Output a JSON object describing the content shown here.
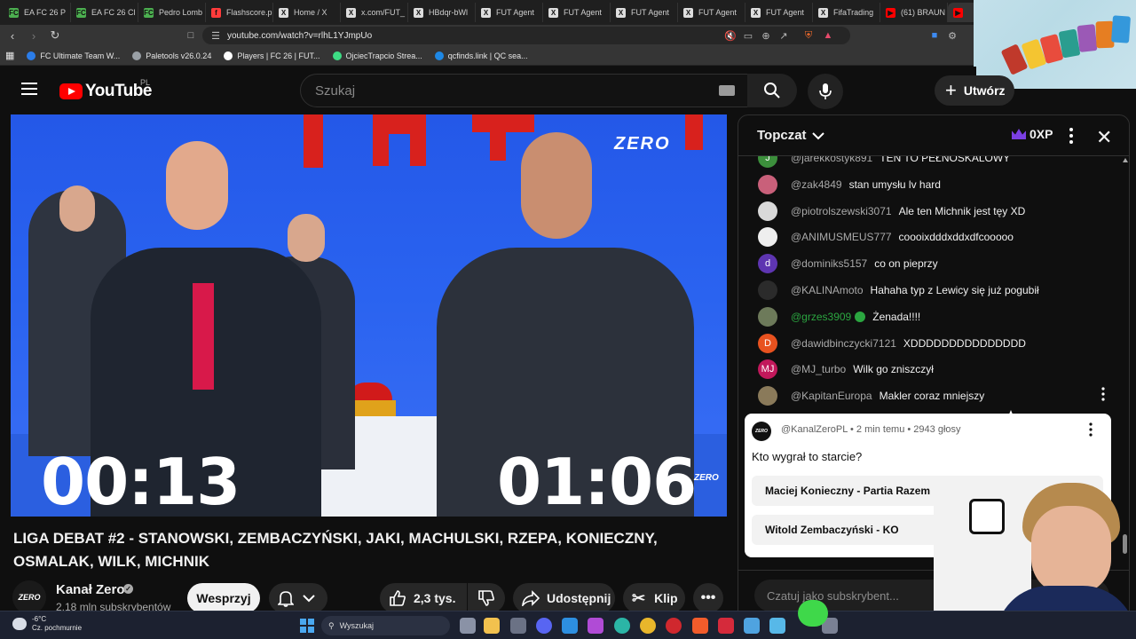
{
  "browser": {
    "tabs": [
      {
        "label": "EA FC 26 P",
        "icon_color": "#4caf50",
        "icon": "FC"
      },
      {
        "label": "EA FC 26 Cl",
        "icon_color": "#4caf50",
        "icon": "FC"
      },
      {
        "label": "Pedro Lomb",
        "icon_color": "#4caf50",
        "icon": "FC"
      },
      {
        "label": "Flashscore.p",
        "icon_color": "#ff3b3b",
        "icon": "f"
      },
      {
        "label": "Home / X",
        "icon_color": "#dddddd",
        "icon": "X"
      },
      {
        "label": "x.com/FUT_",
        "icon_color": "#dddddd",
        "icon": "X"
      },
      {
        "label": "HBdqr-bWl",
        "icon_color": "#dddddd",
        "icon": "X"
      },
      {
        "label": "FUT Agent",
        "icon_color": "#dddddd",
        "icon": "X"
      },
      {
        "label": "FUT Agent",
        "icon_color": "#dddddd",
        "icon": "X"
      },
      {
        "label": "FUT Agent",
        "icon_color": "#dddddd",
        "icon": "X"
      },
      {
        "label": "FUT Agent",
        "icon_color": "#dddddd",
        "icon": "X"
      },
      {
        "label": "FUT Agent",
        "icon_color": "#dddddd",
        "icon": "X"
      },
      {
        "label": "FifaTrading",
        "icon_color": "#dddddd",
        "icon": "X"
      },
      {
        "label": "(61) BRAUN",
        "icon_color": "#ff0000",
        "icon": "▶"
      },
      {
        "label": "",
        "icon_color": "#ff0000",
        "icon": "▶"
      }
    ],
    "url": "youtube.com/watch?v=rlhL1YJmpUo",
    "bookmarks": [
      {
        "label": "FC Ultimate Team W..."
      },
      {
        "label": "Paletools v26.0.24"
      },
      {
        "label": "Players | FC 26 | FUT..."
      },
      {
        "label": "OjciecTrapcio Strea..."
      },
      {
        "label": "qcfinds.link | QC sea..."
      }
    ]
  },
  "youtube": {
    "logo_text": "YouTube",
    "country_code": "PL",
    "search_placeholder": "Szukaj",
    "create_label": "Utwórz"
  },
  "video": {
    "scoreboard_left": "00:13",
    "scoreboard_right": "01:06",
    "broadcaster_logo": "ZERO",
    "title": "LIGA DEBAT #2 - STANOWSKI, ZEMBACZYŃSKI, JAKI, MACHULSKI, RZEPA, KONIECZNY, OSMALAK, WILK, MICHNIK"
  },
  "channel": {
    "name": "Kanał Zero",
    "avatar_text": "ZERO",
    "subscribers": "2,18 mln subskrybentów",
    "support_label": "Wesprzyj"
  },
  "actions": {
    "likes": "2,3 tys.",
    "share_label": "Udostępnij",
    "clip_label": "Klip"
  },
  "chat": {
    "mode_label": "Topczat",
    "xp_label": "0XP",
    "messages": [
      {
        "author": "@jarekkostyk891",
        "text": "TEN TO PEŁNOSKALOWY",
        "avatar_color": "#3c8f3c",
        "avatar_text": "J",
        "mod": false
      },
      {
        "author": "@zak4849",
        "text": "stan umysłu lv hard",
        "avatar_color": "#c9607a",
        "avatar_text": "",
        "mod": false
      },
      {
        "author": "@piotrolszewski3071",
        "text": "Ale ten Michnik jest tęy XD",
        "avatar_color": "#d9d9d9",
        "avatar_text": "",
        "mod": false
      },
      {
        "author": "@ANIMUSMEUS777",
        "text": "coooixdddxddxdfcooooo",
        "avatar_color": "#eeeeee",
        "avatar_text": "",
        "mod": false
      },
      {
        "author": "@dominiks5157",
        "text": "co on pieprzy",
        "avatar_color": "#5e35b1",
        "avatar_text": "d",
        "mod": false
      },
      {
        "author": "@KALINAmoto",
        "text": "Hahaha typ z Lewicy się już pogubił",
        "avatar_color": "#2b2b2b",
        "avatar_text": "",
        "mod": false
      },
      {
        "author": "@grzes3909",
        "text": "Żenada!!!!",
        "avatar_color": "#6d7a5a",
        "avatar_text": "",
        "mod": true
      },
      {
        "author": "@dawidbinczycki7121",
        "text": "XDDDDDDDDDDDDDDD",
        "avatar_color": "#e8521f",
        "avatar_text": "D",
        "mod": false
      },
      {
        "author": "@MJ_turbo",
        "text": "Wilk go zniszczył",
        "avatar_color": "#c2185b",
        "avatar_text": "MJ",
        "mod": false
      },
      {
        "author": "@KapitanEuropa",
        "text": "Makler coraz mniejszy",
        "avatar_color": "#8a7a5a",
        "avatar_text": "",
        "mod": false
      }
    ],
    "poll": {
      "meta": "@KanalZeroPL • 2 min temu • 2943 głosy",
      "question": "Kto wygrał to starcie?",
      "options": [
        "Maciej Konieczny - Partia Razem",
        "Witold Zembaczyński - KO"
      ]
    },
    "input_placeholder": "Czatuj jako subskrybent..."
  },
  "taskbar": {
    "temperature": "-6°C",
    "weather": "Cz. pochmurnie",
    "search_label": "Wyszukaj"
  },
  "colors": {
    "yt_red": "#ff0000",
    "studio_blue": "#2a63f0",
    "mod_green": "#2ba640"
  }
}
